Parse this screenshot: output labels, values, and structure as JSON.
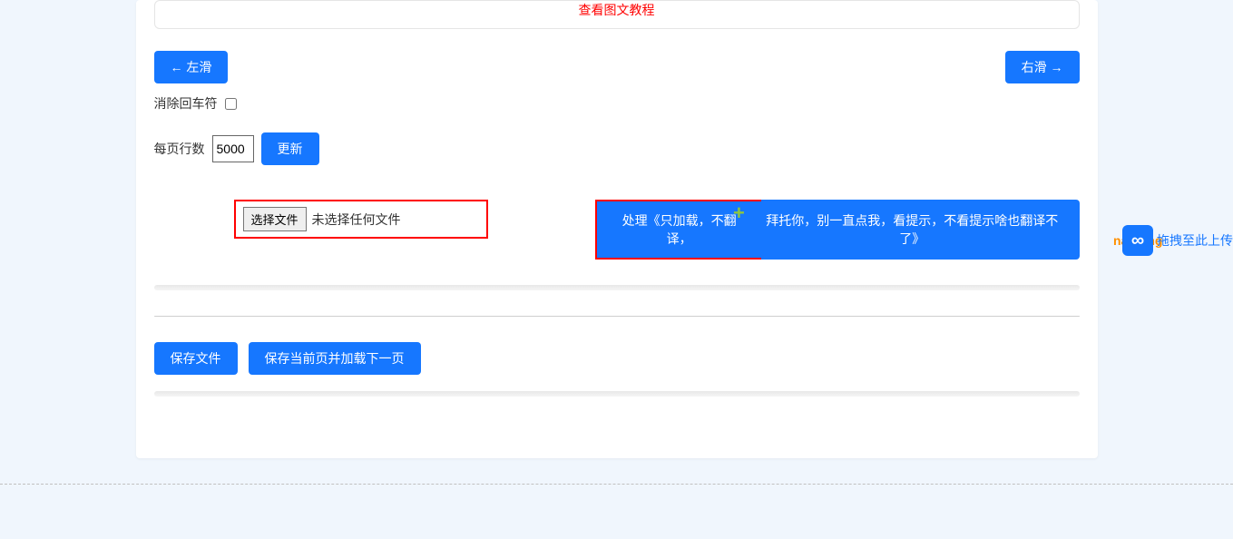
{
  "tutorial": {
    "link_text": "查看图文教程"
  },
  "nav": {
    "left_button": "← 左滑",
    "right_button": "右滑 →"
  },
  "checkbox": {
    "label": "消除回车符",
    "checked": false
  },
  "rows": {
    "label": "每页行数",
    "value": "5000",
    "update_button": "更新"
  },
  "file": {
    "choose_button": "选择文件",
    "status_text": "未选择任何文件"
  },
  "process": {
    "button_left": "处理《只加载，不翻译，",
    "button_right": "拜托你，别一直点我，看提示，不看提示啥也翻译不了》",
    "plus_icon": "+"
  },
  "save": {
    "save_file_button": "保存文件",
    "save_next_button": "保存当前页并加载下一页"
  },
  "side": {
    "orange_text": "nan ong",
    "blue_text": "拖拽至此上传",
    "icon_glyph": "∞"
  }
}
